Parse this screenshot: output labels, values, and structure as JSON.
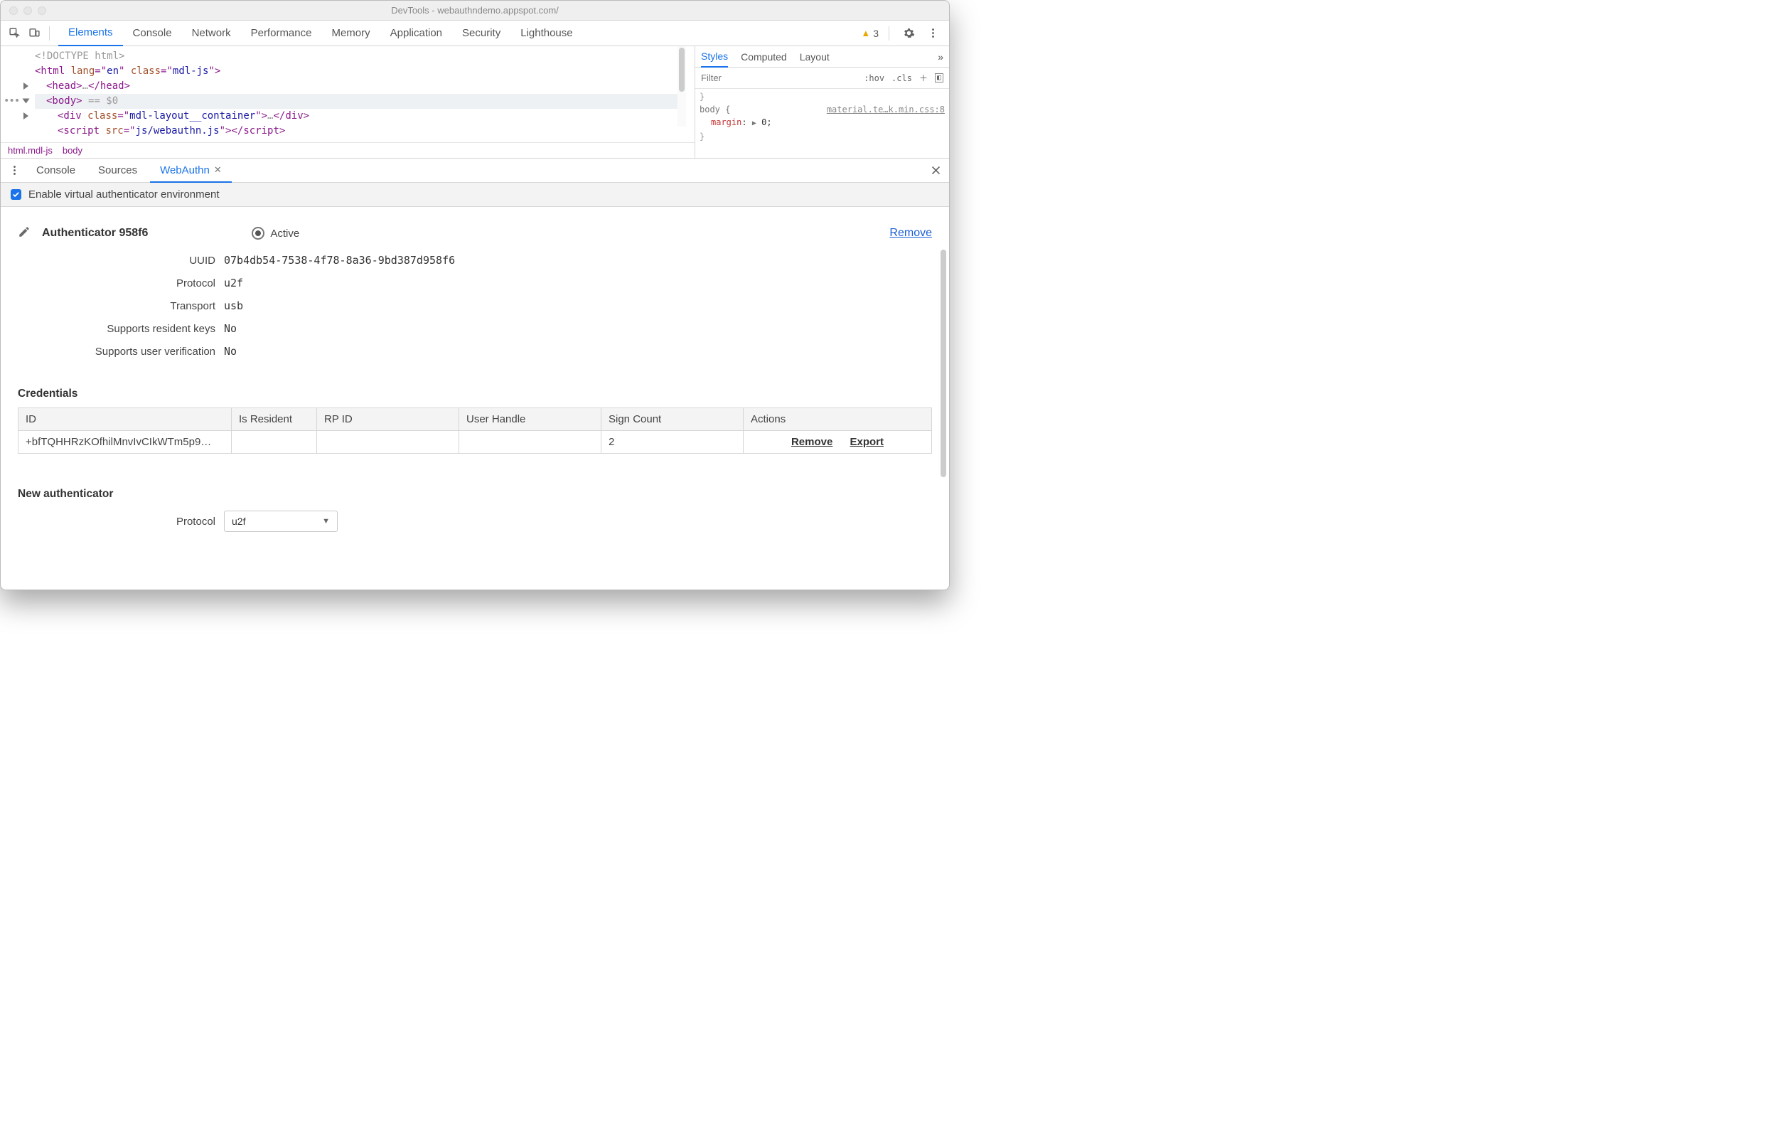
{
  "window": {
    "title": "DevTools - webauthndemo.appspot.com/"
  },
  "toolbar": {
    "warn_count": "3"
  },
  "main_tabs": [
    "Elements",
    "Console",
    "Network",
    "Performance",
    "Memory",
    "Application",
    "Security",
    "Lighthouse"
  ],
  "elements": {
    "lines": {
      "l0": "<!DOCTYPE html>",
      "l1a": "<html ",
      "l1b": "lang",
      "l1c": "=\"",
      "l1d": "en",
      "l1e": "\" ",
      "l1f": "class",
      "l1g": "=\"",
      "l1h": "mdl-js",
      "l1i": "\">",
      "l2a": "<head>",
      "l2b": "…",
      "l2c": "</head>",
      "l3a": "<body>",
      "l3b": " == $0",
      "l4a": "<div ",
      "l4b": "class",
      "l4c": "=\"",
      "l4d": "mdl-layout__container",
      "l4e": "\">",
      "l4f": "…",
      "l4g": "</div>",
      "l5a": "<script ",
      "l5b": "src",
      "l5c": "=\"",
      "l5d": "js/webauthn.js",
      "l5e": "\">",
      "l5f": "</scr",
      "l5g": "ipt>"
    },
    "breadcrumb": [
      "html.mdl-js",
      "body"
    ]
  },
  "styles": {
    "tabs": [
      "Styles",
      "Computed",
      "Layout"
    ],
    "filter_placeholder": "Filter",
    "hov": ":hov",
    "cls": ".cls",
    "selector": "body {",
    "link": "material.te…k.min.css:8",
    "prop_name": "margin",
    "prop_val": "0;",
    "close_brace1": "}",
    "close_brace2": "}"
  },
  "drawer_tabs": [
    "Console",
    "Sources",
    "WebAuthn"
  ],
  "enable_label": "Enable virtual authenticator environment",
  "authenticator": {
    "title": "Authenticator 958f6",
    "active_label": "Active",
    "remove_label": "Remove",
    "rows": {
      "uuid_label": "UUID",
      "uuid_val": "07b4db54-7538-4f78-8a36-9bd387d958f6",
      "protocol_label": "Protocol",
      "protocol_val": "u2f",
      "transport_label": "Transport",
      "transport_val": "usb",
      "srk_label": "Supports resident keys",
      "srk_val": "No",
      "suv_label": "Supports user verification",
      "suv_val": "No"
    }
  },
  "credentials": {
    "heading": "Credentials",
    "headers": {
      "id": "ID",
      "resident": "Is Resident",
      "rpid": "RP ID",
      "user_handle": "User Handle",
      "sign_count": "Sign Count",
      "actions": "Actions"
    },
    "row": {
      "id": "+bfTQHHRzKOfhilMnvIvCIkWTm5p9…",
      "resident": "",
      "rpid": "",
      "user_handle": "",
      "sign_count": "2",
      "remove": "Remove",
      "export": "Export"
    }
  },
  "new_auth": {
    "heading": "New authenticator",
    "protocol_label": "Protocol",
    "protocol_value": "u2f"
  }
}
